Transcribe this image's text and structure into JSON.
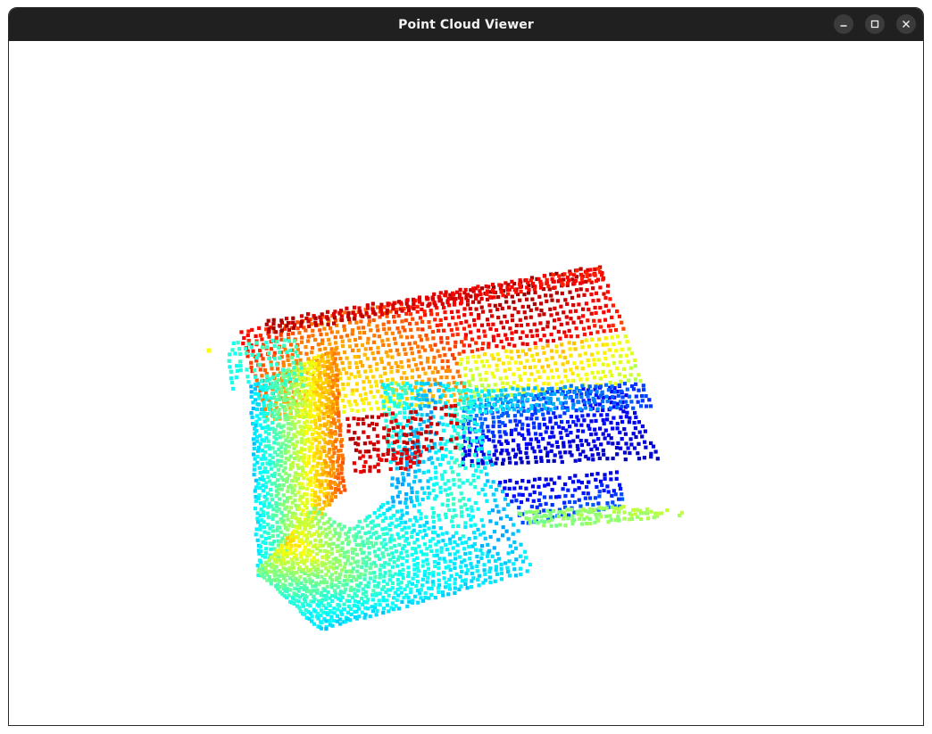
{
  "window": {
    "title": "Point Cloud Viewer",
    "controls": [
      {
        "name": "minimize",
        "icon": "minimize-icon"
      },
      {
        "name": "maximize",
        "icon": "maximize-icon"
      },
      {
        "name": "close",
        "icon": "close-icon"
      }
    ]
  },
  "viewer": {
    "background": "#ffffff",
    "colormap": "jet",
    "point_shape": "square"
  }
}
